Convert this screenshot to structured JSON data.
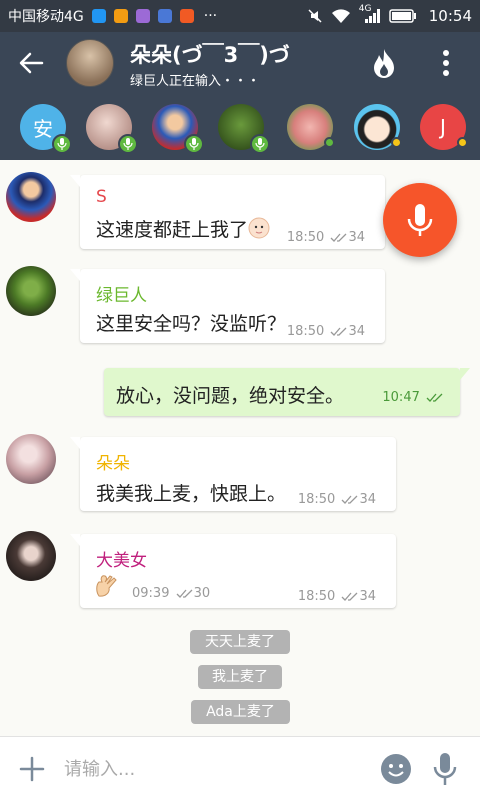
{
  "statusbar": {
    "carrier": "中国移动4G",
    "time": "10:54",
    "network": "4G",
    "app_colors": [
      "#2196f3",
      "#f39c12",
      "#9c6ad6",
      "#4a78d6",
      "#f15a24"
    ]
  },
  "header": {
    "title": "朵朵(づ￣3￣)づ",
    "status": "绿巨人正在输入・・・"
  },
  "participants": [
    {
      "name": "安",
      "color": "#4fb3e8",
      "badge": "mic"
    },
    {
      "name": "",
      "badge": "mic"
    },
    {
      "name": "",
      "badge": "mic"
    },
    {
      "name": "",
      "badge": "mic"
    },
    {
      "name": "",
      "badge": "online"
    },
    {
      "name": "",
      "badge": "away"
    },
    {
      "name": "J",
      "color": "#e84545",
      "badge": "away"
    }
  ],
  "messages": [
    {
      "sender": "S",
      "sender_color": "#e5484d",
      "text": "这速度都赶上我了",
      "emoji": "baby-face-icon",
      "time": "18:50",
      "count": "34"
    },
    {
      "sender": "绿巨人",
      "sender_color": "#6bb82e",
      "text": "这里安全吗？没监听？",
      "time": "18:50",
      "count": "34"
    },
    {
      "text": "放心，没问题，绝对安全。",
      "time": "10:47",
      "mine": true
    },
    {
      "sender": "朵朵",
      "sender_color": "#f0b400",
      "text": "我美我上麦，快跟上。",
      "time": "18:50",
      "count": "34"
    },
    {
      "sender": "大美女",
      "sender_color": "#c0207d",
      "emoji": "ok-hand-icon",
      "inner_time": "09:39",
      "inner_count": "30",
      "time": "18:50",
      "count": "34"
    }
  ],
  "system_messages": [
    "天天上麦了",
    "我上麦了",
    "Ada上麦了"
  ],
  "input": {
    "placeholder": "请输入..."
  },
  "colors": {
    "header": "#3a4656",
    "fab": "#f6552a",
    "mic_badge": "#5fb940",
    "online": "#5fb940",
    "away": "#f5c518"
  }
}
